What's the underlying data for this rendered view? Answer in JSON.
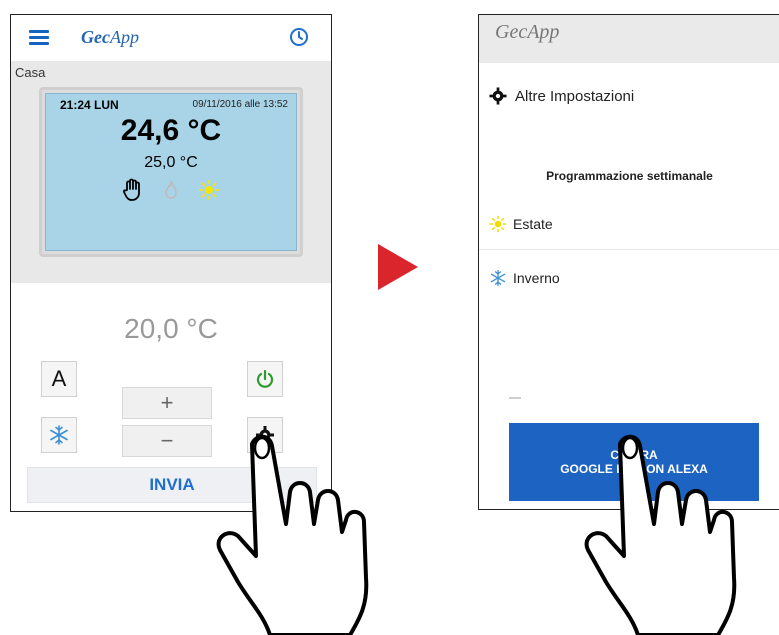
{
  "screen1": {
    "brand_prefix": "Gec",
    "brand_suffix": "App",
    "room_label": "Casa",
    "thermostat": {
      "time": "21:24 LUN",
      "last_update": "09/11/2016 alle 13:52",
      "current_temp": "24,6 °C",
      "set_temp": "25,0 °C",
      "mode_icons": [
        "hand-icon",
        "flame-icon",
        "sun-icon"
      ]
    },
    "setpoint": "20,0 °C",
    "buttons": {
      "auto_label": "A",
      "plus_label": "+",
      "minus_label": "−",
      "send_label": "INVIA"
    },
    "colors": {
      "accent": "#1e6fd0",
      "power": "#2e9b2e",
      "lcd": "#a9d4e8"
    }
  },
  "screen2": {
    "brand_prefix": "Gec",
    "brand_suffix": "App",
    "other_settings": "Altre Impostazioni",
    "weekly_program": "Programmazione settimanale",
    "summer": "Estate",
    "winter": "Inverno",
    "config_line1": "CO      URA",
    "config_line2": "GOOGLE HON       ON ALEXA",
    "colors": {
      "button": "#1c63c2"
    }
  },
  "arrow_color": "#d9252b"
}
